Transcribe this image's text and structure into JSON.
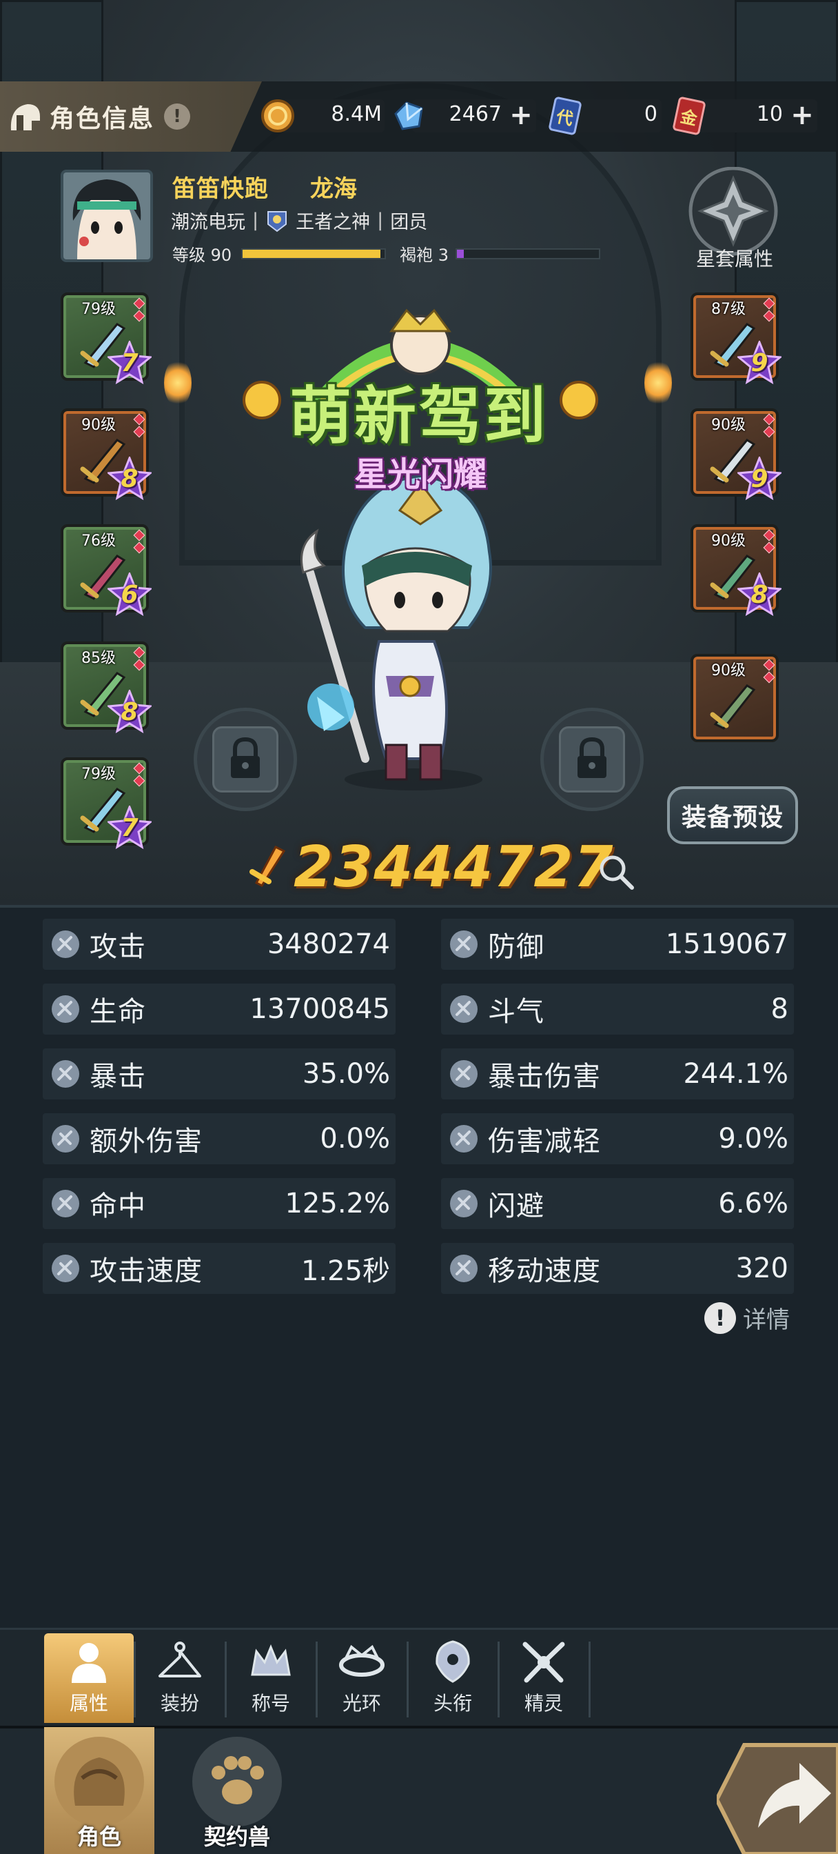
{
  "header": {
    "title": "角色信息",
    "info_badge": "!"
  },
  "currencies": [
    {
      "name": "gold",
      "value": "8.4M"
    },
    {
      "name": "crystal",
      "value": "2467"
    },
    {
      "name": "ticket_dai",
      "icon_text": "代",
      "value": "0"
    },
    {
      "name": "ticket_jin",
      "icon_text": "金",
      "value": "10"
    }
  ],
  "profile": {
    "name": "笛笛快跑",
    "server_name": "龙海",
    "title": "潮流电玩",
    "guild": "王者之神",
    "role": "团员",
    "level_label": "等级 90",
    "level_progress": 0.97,
    "robe_label": "褐袍 3",
    "robe_progress": 0.05
  },
  "set_attributes_label": "星套属性",
  "equipment_left": [
    {
      "level": "79级",
      "stars": "7",
      "rarity": "green"
    },
    {
      "level": "90级",
      "stars": "8",
      "rarity": "orange"
    },
    {
      "level": "76级",
      "stars": "6",
      "rarity": "green"
    },
    {
      "level": "85级",
      "stars": "8",
      "rarity": "green"
    },
    {
      "level": "79级",
      "stars": "7",
      "rarity": "green"
    }
  ],
  "equipment_right": [
    {
      "level": "87级",
      "stars": "9",
      "rarity": "orange"
    },
    {
      "level": "90级",
      "stars": "9",
      "rarity": "orange"
    },
    {
      "level": "90级",
      "stars": "8",
      "rarity": "orange"
    },
    {
      "level": "90级",
      "stars": "",
      "rarity": "orange"
    }
  ],
  "banner": {
    "main": "萌新驾到",
    "sub": "星光闪耀"
  },
  "preset_button": "装备预设",
  "combat_power": "23444727",
  "stats_left": [
    {
      "label": "攻击",
      "value": "3480274"
    },
    {
      "label": "生命",
      "value": "13700845"
    },
    {
      "label": "暴击",
      "value": "35.0%"
    },
    {
      "label": "额外伤害",
      "value": "0.0%"
    },
    {
      "label": "命中",
      "value": "125.2%"
    },
    {
      "label": "攻击速度",
      "value": "1.25秒"
    }
  ],
  "stats_right": [
    {
      "label": "防御",
      "value": "1519067"
    },
    {
      "label": "斗气",
      "value": "8"
    },
    {
      "label": "暴击伤害",
      "value": "244.1%"
    },
    {
      "label": "伤害减轻",
      "value": "9.0%"
    },
    {
      "label": "闪避",
      "value": "6.6%"
    },
    {
      "label": "移动速度",
      "value": "320"
    }
  ],
  "details_label": "详情",
  "tabs": [
    {
      "label": "属性",
      "icon": "person-icon",
      "active": true
    },
    {
      "label": "装扮",
      "icon": "hanger-icon",
      "active": false
    },
    {
      "label": "称号",
      "icon": "crown-icon",
      "active": false
    },
    {
      "label": "光环",
      "icon": "halo-icon",
      "active": false
    },
    {
      "label": "头衔",
      "icon": "emblem-icon",
      "active": false
    },
    {
      "label": "精灵",
      "icon": "fairy-icon",
      "active": false
    }
  ],
  "bottom_tabs": [
    {
      "label": "角色",
      "active": true
    },
    {
      "label": "契约兽",
      "active": false
    }
  ],
  "colors": {
    "accent_gold": "#f6c640",
    "name_yellow": "#f7d35b",
    "level_bar": "#f2c53b",
    "robe_bar": "#9b4fd8",
    "panel_bg": "#1a232a",
    "stat_row_bg": "#222d35"
  }
}
